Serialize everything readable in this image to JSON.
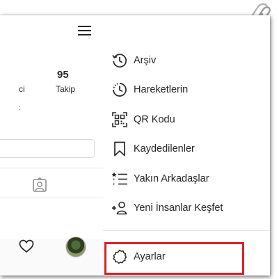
{
  "profile": {
    "following_count": "95",
    "following_label": "Takip",
    "cut_label": "ci",
    "cut_mark": "̧"
  },
  "menu": {
    "items": [
      {
        "label": "Arşiv",
        "icon": "archive-history-icon"
      },
      {
        "label": "Hareketlerin",
        "icon": "activity-clock-icon"
      },
      {
        "label": "QR Kodu",
        "icon": "qr-code-icon"
      },
      {
        "label": "Kaydedilenler",
        "icon": "bookmark-icon"
      },
      {
        "label": "Yakın Arkadaşlar",
        "icon": "close-friends-icon"
      },
      {
        "label": "Yeni İnsanlar Keşfet",
        "icon": "add-person-icon"
      }
    ],
    "settings_label": "Ayarlar",
    "settings_icon": "settings-gear-icon"
  },
  "colors": {
    "highlight": "#d71f27",
    "text": "#262626",
    "divider": "#e2e2e2"
  }
}
